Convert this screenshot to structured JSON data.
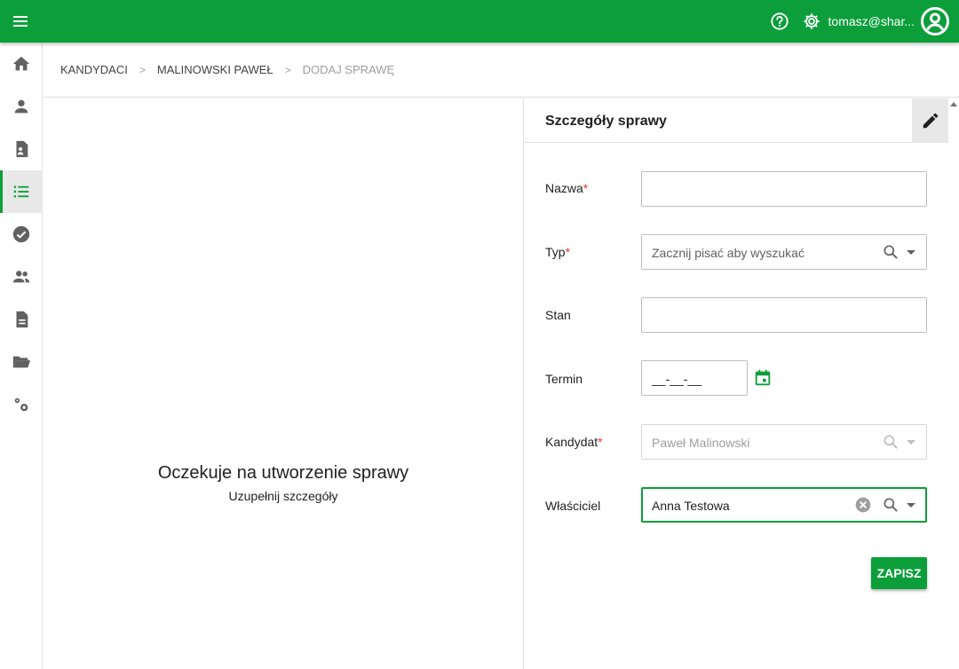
{
  "topbar": {
    "user_email": "tomasz@shar...",
    "accent_color": "#0c9e3a",
    "icons": [
      "menu-icon",
      "help-icon",
      "gear-icon",
      "account-circle-icon"
    ]
  },
  "sidebar": {
    "items": [
      {
        "name": "home",
        "icon": "home-icon",
        "active": false
      },
      {
        "name": "person",
        "icon": "person-icon",
        "active": false
      },
      {
        "name": "document-person",
        "icon": "document-person-icon",
        "active": false
      },
      {
        "name": "list",
        "icon": "list-icon",
        "active": true
      },
      {
        "name": "check",
        "icon": "check-circle-icon",
        "active": false
      },
      {
        "name": "people",
        "icon": "people-icon",
        "active": false
      },
      {
        "name": "document",
        "icon": "document-icon",
        "active": false
      },
      {
        "name": "folder",
        "icon": "folder-open-icon",
        "active": false
      },
      {
        "name": "settings",
        "icon": "cogs-icon",
        "active": false
      }
    ]
  },
  "breadcrumb": {
    "items": [
      "KANDYDACI",
      "MALINOWSKI PAWEŁ",
      "DODAJ SPRAWĘ"
    ],
    "separator": ">"
  },
  "main": {
    "empty_title": "Oczekuje na utworzenie sprawy",
    "empty_subtitle": "Uzupełnij szczegóły"
  },
  "details": {
    "title": "Szczegóły sprawy",
    "fields": {
      "nazwa": {
        "label": "Nazwa",
        "required": "*",
        "value": ""
      },
      "typ": {
        "label": "Typ",
        "required": "*",
        "placeholder": "Zacznij pisać aby wyszukać"
      },
      "stan": {
        "label": "Stan",
        "value": ""
      },
      "termin": {
        "label": "Termin",
        "value": "__-__-__"
      },
      "kandydat": {
        "label": "Kandydat",
        "required": "*",
        "value": "Paweł Malinowski"
      },
      "wlasciciel": {
        "label": "Właściciel",
        "value": "Anna Testowa"
      }
    },
    "save_label": "ZAPISZ"
  }
}
